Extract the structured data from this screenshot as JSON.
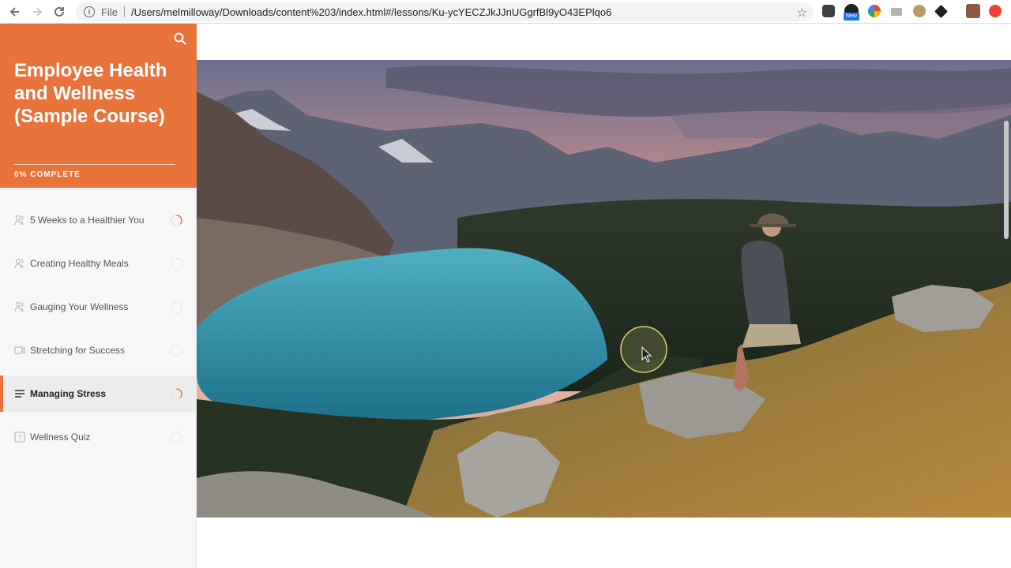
{
  "browser": {
    "scheme": "File",
    "url": "/Users/melmilloway/Downloads/content%203/index.html#/lessons/Ku-ycYECZJkJJnUGgrfBl9yO43EPlqo6",
    "extension_badge": "New"
  },
  "course": {
    "title": "Employee Health and Wellness (Sample Course)",
    "progress_label": "0% COMPLETE",
    "progress_percent": 0,
    "accent_color": "#e8743b"
  },
  "lessons": [
    {
      "label": "5 Weeks to a Healthier You",
      "icon": "people-icon",
      "status": "in-progress"
    },
    {
      "label": "Creating Healthy Meals",
      "icon": "people-icon",
      "status": "not-started"
    },
    {
      "label": "Gauging Your Wellness",
      "icon": "people-icon",
      "status": "not-started"
    },
    {
      "label": "Stretching for Success",
      "icon": "video-icon",
      "status": "not-started"
    },
    {
      "label": "Managing Stress",
      "icon": "text-lines-icon",
      "status": "in-progress",
      "active": true
    },
    {
      "label": "Wellness Quiz",
      "icon": "quiz-icon",
      "status": "not-started"
    }
  ]
}
